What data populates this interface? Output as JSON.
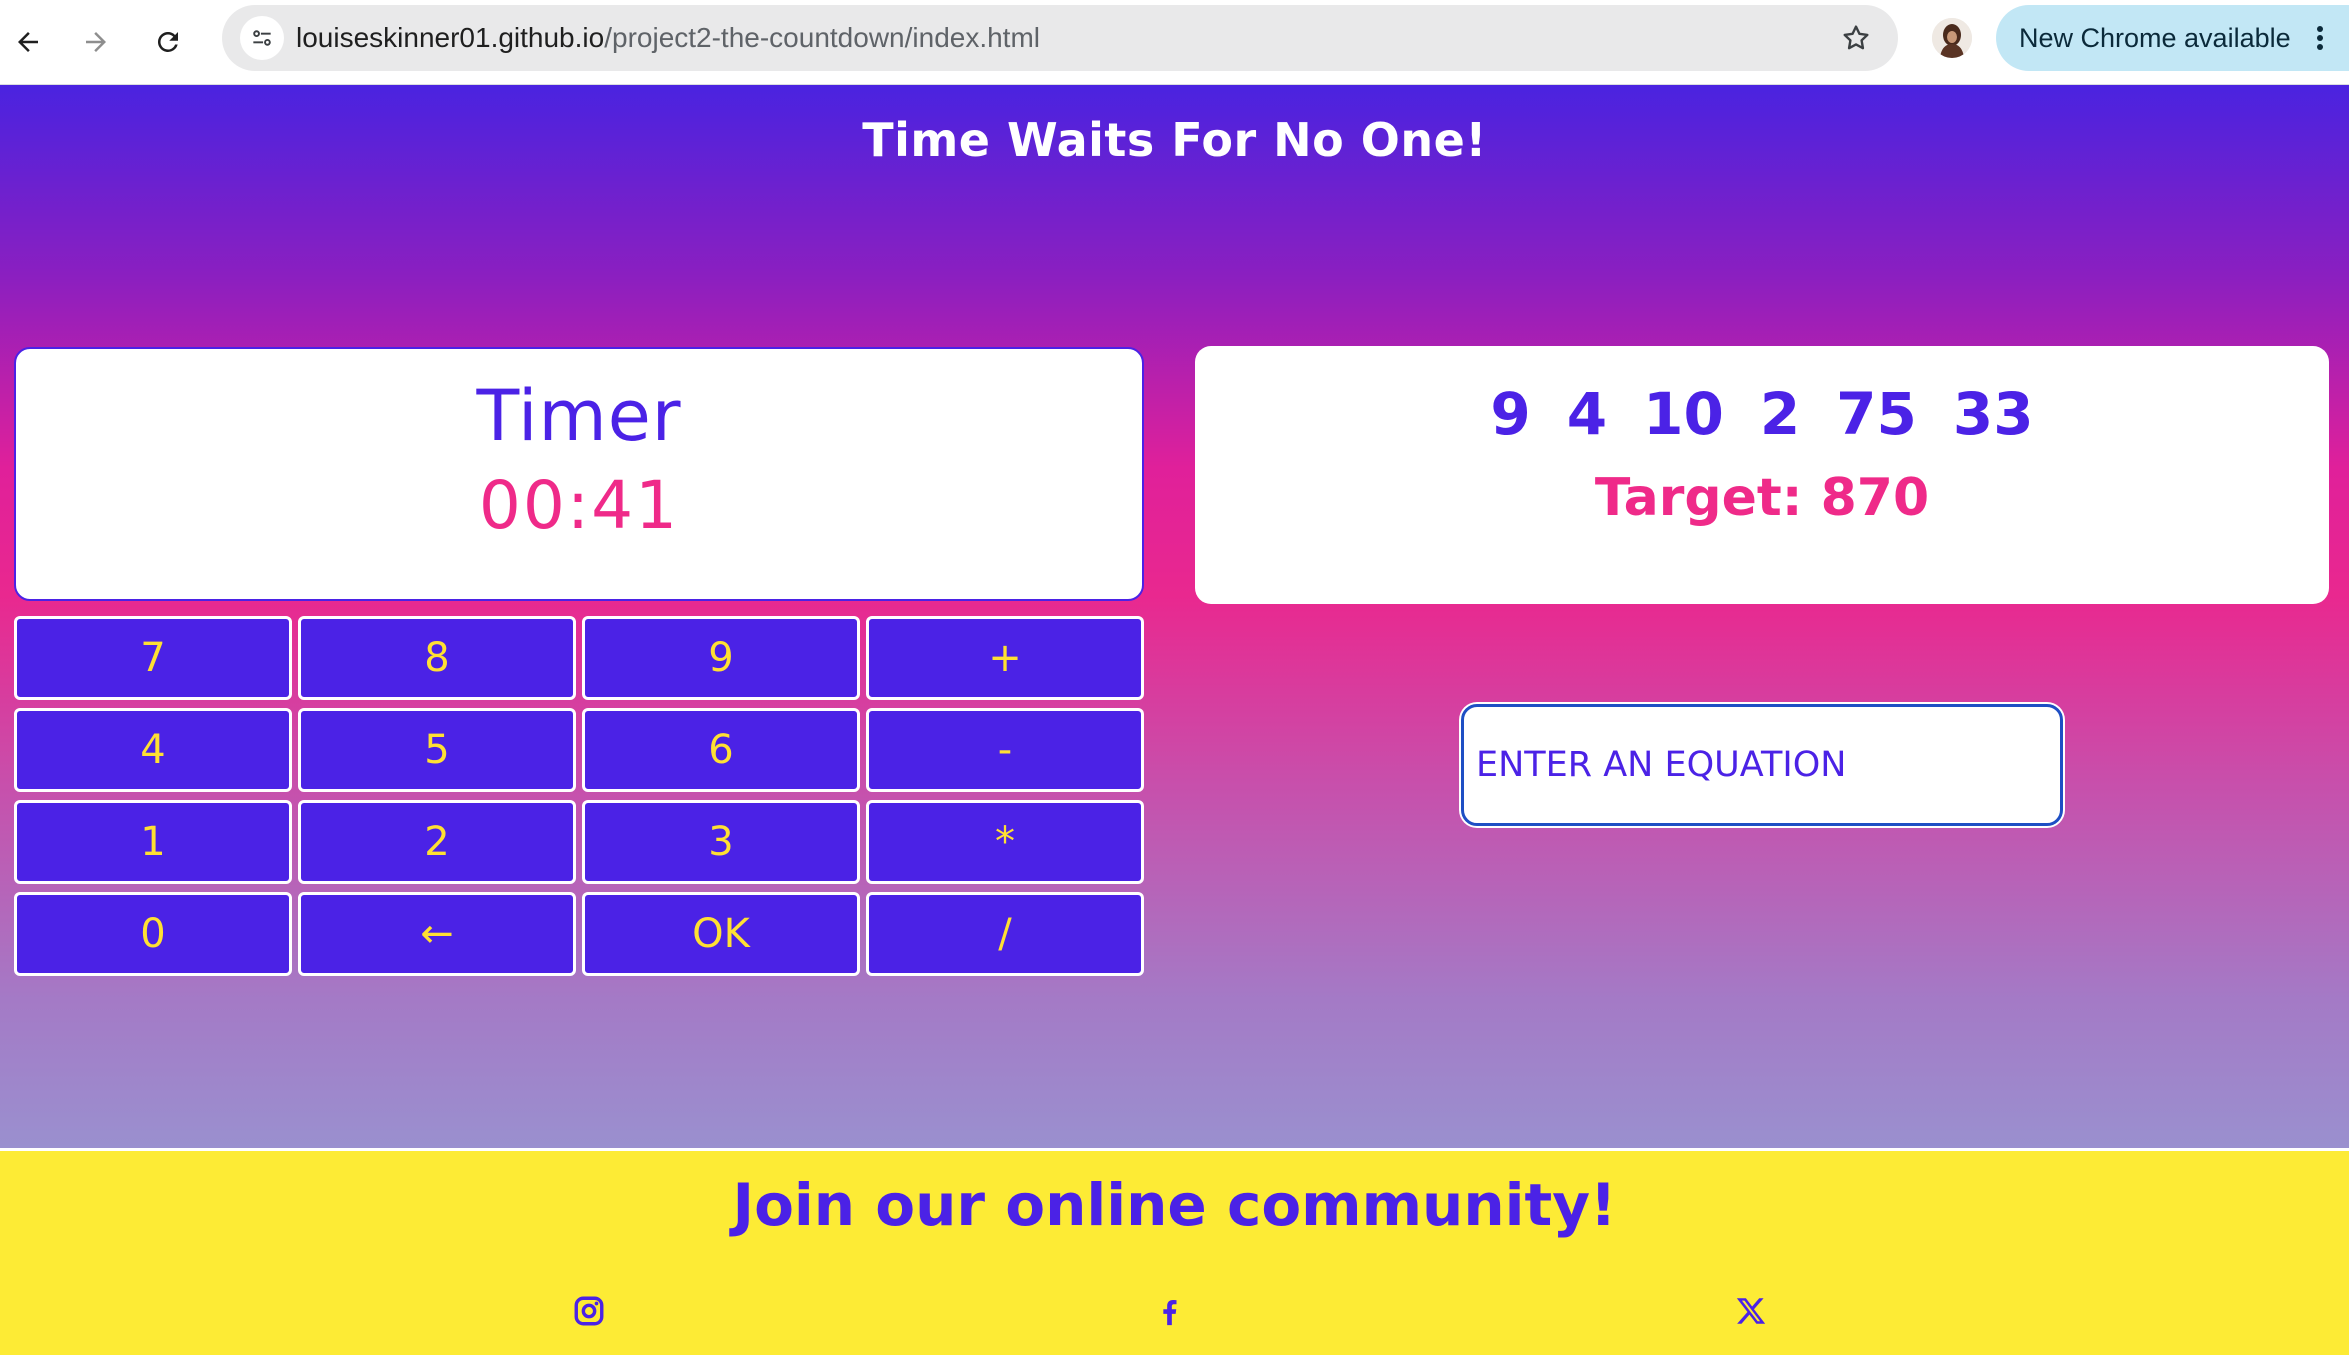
{
  "browser": {
    "url_host": "louiseskinner01.github.io",
    "url_path": "/project2-the-countdown/index.html",
    "update_label": "New Chrome available"
  },
  "page": {
    "headline": "Time Waits For No One!",
    "timer": {
      "label": "Timer",
      "value": "00:41"
    },
    "numbers": [
      "9",
      "4",
      "10",
      "2",
      "75",
      "33"
    ],
    "target_label": "Target: 870",
    "keypad": [
      "7",
      "8",
      "9",
      "+",
      "4",
      "5",
      "6",
      "-",
      "1",
      "2",
      "3",
      "*",
      "0",
      "←",
      "OK",
      "/"
    ],
    "equation_placeholder": "ENTER AN EQUATION"
  },
  "footer": {
    "title": "Join our online community!",
    "social_icons": [
      "instagram-icon",
      "facebook-icon",
      "x-icon"
    ]
  },
  "colors": {
    "accent_purple": "#4b22e6",
    "accent_pink": "#ef2a89",
    "key_text": "#ffe033",
    "footer_bg": "#fdeb35"
  }
}
